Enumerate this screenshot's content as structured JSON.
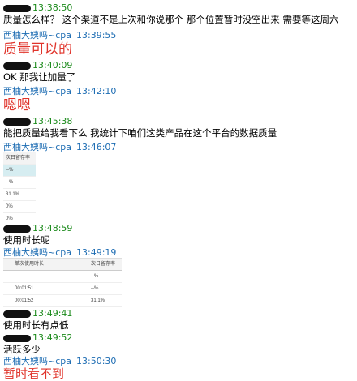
{
  "messages": [
    {
      "time": "13:38:50",
      "text": "质量怎么样？ 这个渠道不是上次和你说那个  那个位置暂时没空出来 需要等这周六"
    },
    {
      "sender": "西柚大姨吗~cpa",
      "time": "13:39:55",
      "text": "质量可以的"
    },
    {
      "time": "13:40:09",
      "text": "OK  那我让加量了"
    },
    {
      "sender": "西柚大姨吗~cpa",
      "time": "13:42:10",
      "text": "嗯嗯"
    },
    {
      "time": "13:45:38",
      "text": "能把质量给我看下么  我统计下咱们这类产品在这个平台的数据质量"
    },
    {
      "sender": "西柚大姨吗~cpa",
      "time": "13:46:07"
    },
    {
      "time": "13:48:59",
      "text": "使用时长呢"
    },
    {
      "sender": "西柚大姨吗~cpa",
      "time": "13:49:19"
    },
    {
      "time": "13:49:41",
      "text": "使用时长有点低"
    },
    {
      "time": "13:49:52",
      "text": "活跃多少"
    },
    {
      "sender": "西柚大姨吗~cpa",
      "time": "13:50:30",
      "text": "暂时看不到"
    }
  ],
  "table1": {
    "header": "次日留存率",
    "rows": [
      "--%",
      "--%",
      "31.1%",
      "0%",
      "0%"
    ]
  },
  "table2": {
    "headers": [
      "单次使用时长",
      "次日留存率"
    ],
    "rows": [
      [
        "--",
        "--%"
      ],
      [
        "00:01:51",
        "--%"
      ],
      [
        "00:01:52",
        "31.1%"
      ]
    ]
  }
}
